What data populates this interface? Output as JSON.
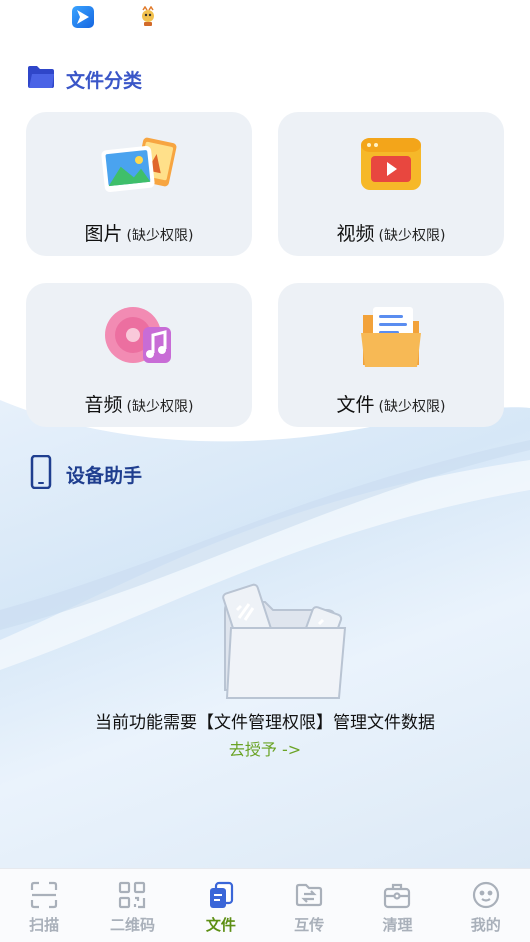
{
  "status_bar": {
    "icons": [
      "blue-app-icon",
      "mascot-app-icon"
    ]
  },
  "file_category": {
    "title": "文件分类",
    "cards": [
      {
        "name": "图片",
        "perm": "(缺少权限)",
        "icon": "photos-icon"
      },
      {
        "name": "视频",
        "perm": "(缺少权限)",
        "icon": "video-player-icon"
      },
      {
        "name": "音频",
        "perm": "(缺少权限)",
        "icon": "music-disc-icon"
      },
      {
        "name": "文件",
        "perm": "(缺少权限)",
        "icon": "document-folder-icon"
      }
    ]
  },
  "device_assistant": {
    "title": "设备助手",
    "empty_message": "当前功能需要【文件管理权限】管理文件数据",
    "grant_link": "去授予 ->"
  },
  "bottom_nav": {
    "items": [
      {
        "label": "扫描",
        "icon": "scan-icon",
        "active": false
      },
      {
        "label": "二维码",
        "icon": "qr-code-icon",
        "active": false
      },
      {
        "label": "文件",
        "icon": "files-icon",
        "active": true
      },
      {
        "label": "互传",
        "icon": "transfer-icon",
        "active": false
      },
      {
        "label": "清理",
        "icon": "cleaner-icon",
        "active": false
      },
      {
        "label": "我的",
        "icon": "profile-icon",
        "active": false
      }
    ]
  },
  "colors": {
    "accent": "#5d8f14",
    "link": "#6aa325",
    "section_title": "#3a56c8",
    "card_bg": "#edf1f6",
    "nav_inactive": "#a9b0ba"
  }
}
